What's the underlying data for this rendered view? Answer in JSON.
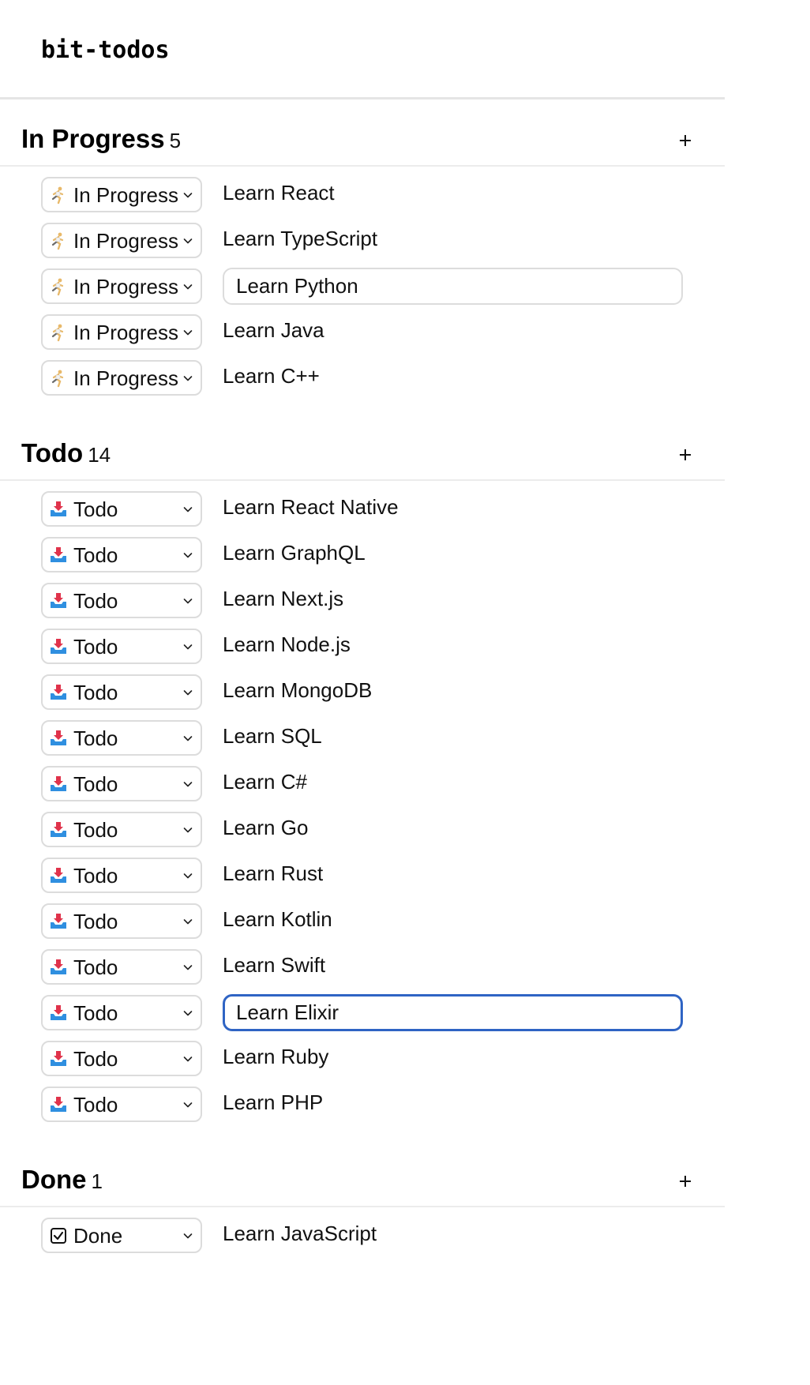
{
  "app": {
    "title": "bit-todos"
  },
  "sections": [
    {
      "title": "In Progress",
      "count": "5",
      "items": [
        {
          "status": "In Progress",
          "status_icon": "runner-icon",
          "text": "Learn React",
          "mode": "text"
        },
        {
          "status": "In Progress",
          "status_icon": "runner-icon",
          "text": "Learn TypeScript",
          "mode": "text"
        },
        {
          "status": "In Progress",
          "status_icon": "runner-icon",
          "text": "Learn Python",
          "mode": "input"
        },
        {
          "status": "In Progress",
          "status_icon": "runner-icon",
          "text": "Learn Java",
          "mode": "text"
        },
        {
          "status": "In Progress",
          "status_icon": "runner-icon",
          "text": "Learn C++",
          "mode": "text"
        }
      ]
    },
    {
      "title": "Todo",
      "count": "14",
      "items": [
        {
          "status": "Todo",
          "status_icon": "inbox-tray-icon",
          "text": "Learn React Native",
          "mode": "text"
        },
        {
          "status": "Todo",
          "status_icon": "inbox-tray-icon",
          "text": "Learn GraphQL",
          "mode": "text"
        },
        {
          "status": "Todo",
          "status_icon": "inbox-tray-icon",
          "text": "Learn Next.js",
          "mode": "text"
        },
        {
          "status": "Todo",
          "status_icon": "inbox-tray-icon",
          "text": "Learn Node.js",
          "mode": "text"
        },
        {
          "status": "Todo",
          "status_icon": "inbox-tray-icon",
          "text": "Learn MongoDB",
          "mode": "text"
        },
        {
          "status": "Todo",
          "status_icon": "inbox-tray-icon",
          "text": "Learn SQL",
          "mode": "text"
        },
        {
          "status": "Todo",
          "status_icon": "inbox-tray-icon",
          "text": "Learn C#",
          "mode": "text"
        },
        {
          "status": "Todo",
          "status_icon": "inbox-tray-icon",
          "text": "Learn Go",
          "mode": "text"
        },
        {
          "status": "Todo",
          "status_icon": "inbox-tray-icon",
          "text": "Learn Rust",
          "mode": "text"
        },
        {
          "status": "Todo",
          "status_icon": "inbox-tray-icon",
          "text": "Learn Kotlin",
          "mode": "text"
        },
        {
          "status": "Todo",
          "status_icon": "inbox-tray-icon",
          "text": "Learn Swift",
          "mode": "text"
        },
        {
          "status": "Todo",
          "status_icon": "inbox-tray-icon",
          "text": "Learn Elixir",
          "mode": "focused"
        },
        {
          "status": "Todo",
          "status_icon": "inbox-tray-icon",
          "text": "Learn Ruby",
          "mode": "text"
        },
        {
          "status": "Todo",
          "status_icon": "inbox-tray-icon",
          "text": "Learn PHP",
          "mode": "text"
        }
      ]
    },
    {
      "title": "Done",
      "count": "1",
      "items": [
        {
          "status": "Done",
          "status_icon": "ballot-box-check-icon",
          "text": "Learn JavaScript",
          "mode": "text"
        }
      ]
    }
  ],
  "colors": {
    "focus_ring": "#2f64c4",
    "border": "#dcdcdc",
    "divider": "#ececec",
    "inbox_blue": "#2f8fe0",
    "inbox_red": "#e0334b"
  }
}
